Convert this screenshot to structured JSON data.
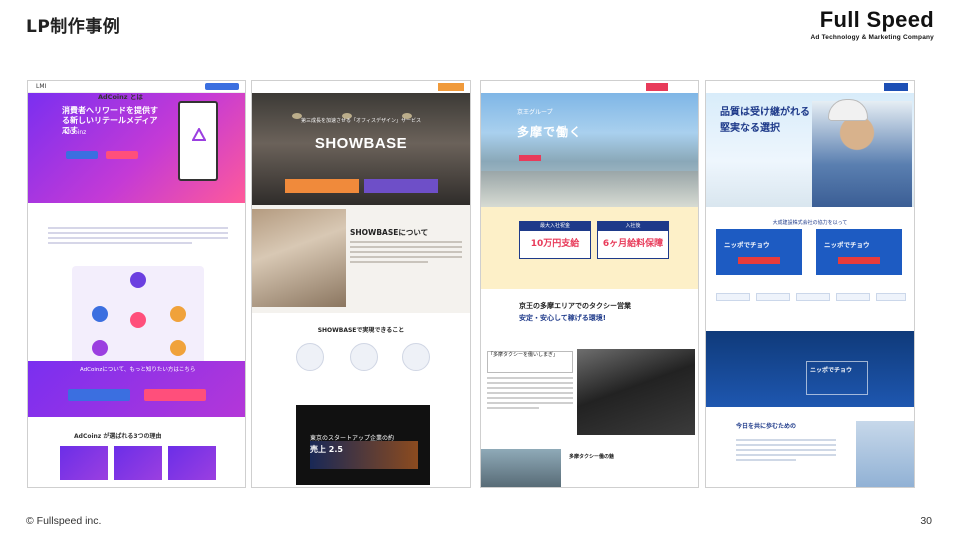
{
  "slide": {
    "title": "LP制作事例",
    "logo_main": "Full Speed",
    "logo_sub": "Ad Technology & Marketing Company",
    "copyright": "© Fullspeed inc.",
    "page_number": "30"
  },
  "panels": {
    "adcoinz": {
      "hero_heading": "消費者へリワードを提供する新しいリテールメディアです",
      "hero_logo": "AdCoinz",
      "about_heading": "AdCoinz とは",
      "band_text": "AdCoinzについて、もっと知りたい方はこちら",
      "reason_heading": "AdCoinz が選ばれる3つの理由"
    },
    "showbase": {
      "hero_sub": "第三成長を加速させる「オフィスデザイン」サービス",
      "hero_title": "SHOWBASE",
      "section_heading": "SHOWBASEについて",
      "can_heading": "SHOWBASEで実現できること",
      "video_text": "東京のスタートアップ企業の約",
      "video_big": "売上 2.5"
    },
    "taxi": {
      "hero_small": "京王グループ",
      "hero_heading": "多摩で働く",
      "box1_head": "最大入社祝金",
      "box1_value": "10万円支給",
      "box2_head": "入社後",
      "box2_value": "6ヶ月給料保障",
      "mid_heading": "京王の多摩エリアでのタクシー営業",
      "mid_heading2": "安定・安心して稼げる環境!",
      "speech_text": "「多摩タクシーを働いしまぎ」",
      "bottom_heading": "多摩タクシー働の魅"
    },
    "construction": {
      "hero_line1": "品質は受け継がれる",
      "hero_line2": "堅実なる選択",
      "cards_heading": "大成建設株式会社の協力を以って",
      "card1": "ニッポでチョウ",
      "card2": "ニッポでチョウ",
      "dark_text": "ニッポでチョウ",
      "low_heading": "今日を共に歩むための"
    }
  }
}
